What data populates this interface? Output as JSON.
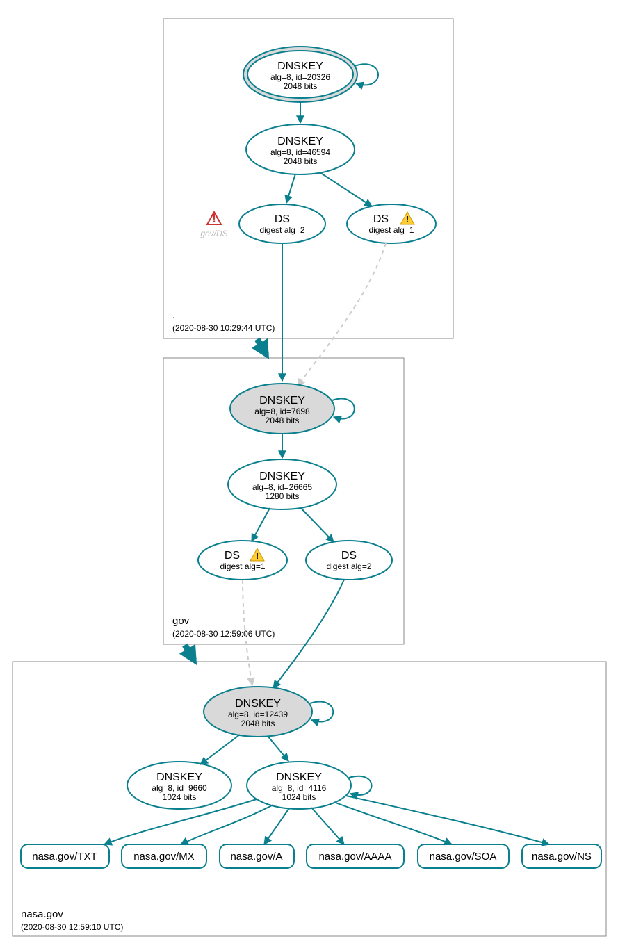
{
  "colors": {
    "teal": "#0a7f8e",
    "grey_fill": "#d9d9d9",
    "box_grey": "#888888"
  },
  "zones": {
    "root": {
      "name": ".",
      "timestamp": "(2020-08-30 10:29:44 UTC)"
    },
    "gov": {
      "name": "gov",
      "timestamp": "(2020-08-30 12:59:06 UTC)"
    },
    "nasa": {
      "name": "nasa.gov",
      "timestamp": "(2020-08-30 12:59:10 UTC)"
    }
  },
  "floating_label": "gov/DS",
  "nodes": {
    "root_ksk": {
      "title": "DNSKEY",
      "l1": "alg=8, id=20326",
      "l2": "2048 bits"
    },
    "root_zsk": {
      "title": "DNSKEY",
      "l1": "alg=8, id=46594",
      "l2": "2048 bits"
    },
    "root_ds2": {
      "title": "DS",
      "l1": "digest alg=2"
    },
    "root_ds1": {
      "title": "DS",
      "l1": "digest alg=1"
    },
    "gov_ksk": {
      "title": "DNSKEY",
      "l1": "alg=8, id=7698",
      "l2": "2048 bits"
    },
    "gov_zsk": {
      "title": "DNSKEY",
      "l1": "alg=8, id=26665",
      "l2": "1280 bits"
    },
    "gov_ds1": {
      "title": "DS",
      "l1": "digest alg=1"
    },
    "gov_ds2": {
      "title": "DS",
      "l1": "digest alg=2"
    },
    "nasa_ksk": {
      "title": "DNSKEY",
      "l1": "alg=8, id=12439",
      "l2": "2048 bits"
    },
    "nasa_zsk1": {
      "title": "DNSKEY",
      "l1": "alg=8, id=9660",
      "l2": "1024 bits"
    },
    "nasa_zsk2": {
      "title": "DNSKEY",
      "l1": "alg=8, id=4116",
      "l2": "1024 bits"
    }
  },
  "rrsets": {
    "txt": "nasa.gov/TXT",
    "mx": "nasa.gov/MX",
    "a": "nasa.gov/A",
    "aaaa": "nasa.gov/AAAA",
    "soa": "nasa.gov/SOA",
    "ns": "nasa.gov/NS"
  }
}
